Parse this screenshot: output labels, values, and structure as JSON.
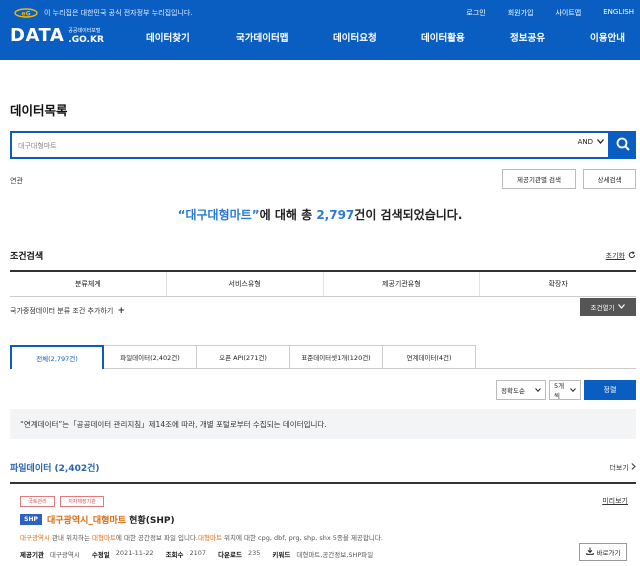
{
  "header": {
    "notice": "이 누리집은 대한민국 공식 전자정부 누리집입니다.",
    "links": [
      "로그인",
      "회원가입",
      "사이트맵",
      "ENGLISH"
    ],
    "brand": {
      "main": "DATA",
      "sub_top": "공공데이터포털",
      "sub_bottom": ".GO.KR"
    },
    "nav": [
      "데이터찾기",
      "국가데이터맵",
      "데이터요청",
      "데이터활용",
      "정보공유",
      "이용안내"
    ]
  },
  "page_title": "데이터목록",
  "search": {
    "value": "",
    "placeholder": "대구대형마트",
    "operator": "AND"
  },
  "related_label": "연관",
  "buttons": {
    "agency_search": "제공기관별 검색",
    "detail_search": "상세검색"
  },
  "result": {
    "keyword": "“대구대형마트”",
    "mid": "에 대해 총 ",
    "count": "2,797",
    "tail": "건이 검색되었습니다."
  },
  "conditions": {
    "title": "조건검색",
    "reset": "초기화",
    "columns": [
      "분류체계",
      "서비스유형",
      "제공기관유형",
      "확장자"
    ],
    "add": "국가중점데이터 분류 조건 추가하기",
    "open": "조건열기"
  },
  "tabs": [
    {
      "label": "전체(2,797건)",
      "active": true
    },
    {
      "label": "파일데이터(2,402건)",
      "active": false
    },
    {
      "label": "오픈 API(271건)",
      "active": false
    },
    {
      "label": "표준데이터셋1개(120건)",
      "active": false
    },
    {
      "label": "연계데이터(4건)",
      "active": false
    }
  ],
  "sort": {
    "order": "정확도순",
    "size": "5개씩",
    "button": "정렬"
  },
  "notice_box": "“연계데이터”는「공공데이터 관리지침」제14조에 따라, 개별 포털로부터 수집되는 데이터입니다.",
  "file_section": {
    "title": "파일데이터 (2,402건)",
    "more": "더보기",
    "item": {
      "tags": [
        "국토관리",
        "지자체장기관"
      ],
      "preview": "미리보기",
      "format": "SHP",
      "title_hl": "대구광역시_대형마트",
      "title_rest": " 현황(SHP)",
      "desc": {
        "a": "대구광역시",
        "b": " 관내 위치하는 ",
        "c": "대형마트",
        "d": "에 대한 공간정보 파일 입니다.",
        "e": "대형마트",
        "f": " 위치에 대한 cpg, dbf, prg, shp, shx 5종을 제공합니다."
      },
      "meta": {
        "provider_label": "제공기관",
        "provider": "대구광역시",
        "modified_label": "수정일",
        "modified": "2021-11-22",
        "views_label": "조회수",
        "views": "2107",
        "downloads_label": "다운로드",
        "downloads": "235",
        "keywords_label": "키워드",
        "keywords": "대형마트,공간정보,SHP파일"
      },
      "download": "바로가기"
    }
  },
  "colors": {
    "primary": "#0a5ec2",
    "highlight": "#e06a0f",
    "tag": "#d94a4a"
  }
}
